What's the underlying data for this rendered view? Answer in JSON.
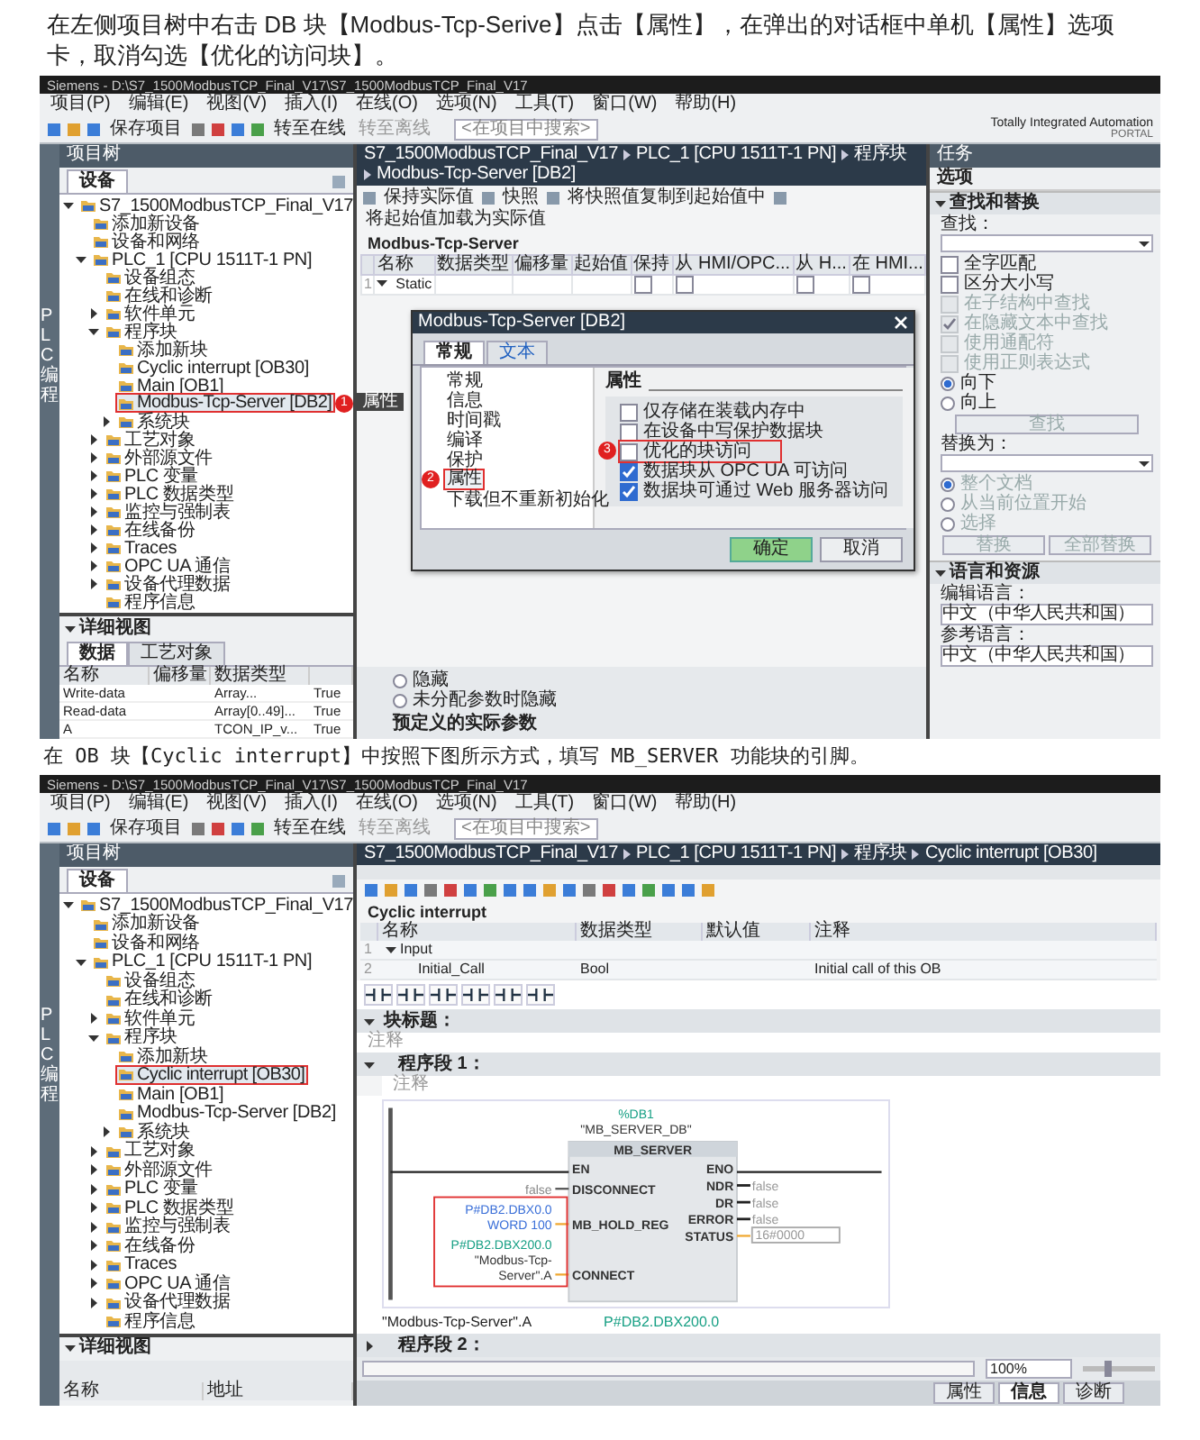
{
  "intro": "在左侧项目树中右击 DB 块【Modbus-Tcp-Serive】点击【属性】，在弹出的对话框中单机【属性】选项卡，取消勾选【优化的访问块】。",
  "screenshot_1": {
    "title": "Siemens - D:\\S7_1500ModbusTCP_Final_V17\\S7_1500ModbusTCP_Final_V17",
    "menu": [
      "项目(P)",
      "编辑(E)",
      "视图(V)",
      "插入(I)",
      "在线(O)",
      "选项(N)",
      "工具(T)",
      "窗口(W)",
      "帮助(H)"
    ],
    "toolbar": {
      "save": "保存项目",
      "online": "转至在线",
      "offline": "转至离线",
      "search_placeholder": "<在项目中搜索>"
    },
    "brand": {
      "line_1": "Totally Integrated Automation",
      "line_2": "PORTAL"
    },
    "side_tab": "PLC 编程",
    "project_tree": {
      "title": "项目树",
      "tab": "设备",
      "items": [
        {
          "label": "S7_1500ModbusTCP_Final_V17",
          "selected": false,
          "expanded": true,
          "children": [
            {
              "label": "添加新设备",
              "selected": false
            },
            {
              "label": "设备和网络",
              "selected": false
            },
            {
              "label": "PLC_1 [CPU 1511T-1 PN]",
              "selected": false,
              "expanded": true,
              "children": [
                {
                  "label": "设备组态",
                  "selected": false
                },
                {
                  "label": "在线和诊断",
                  "selected": false
                },
                {
                  "label": "软件单元",
                  "selected": false,
                  "expanded": false
                },
                {
                  "label": "程序块",
                  "selected": false,
                  "expanded": true,
                  "children": [
                    {
                      "label": "添加新块",
                      "selected": false
                    },
                    {
                      "label": "Cyclic interrupt [OB30]",
                      "selected": false
                    },
                    {
                      "label": "Main [OB1]",
                      "selected": false
                    },
                    {
                      "label": "Modbus-Tcp-Server [DB2]",
                      "selected": true,
                      "marker": "1",
                      "tooltip": "属性"
                    },
                    {
                      "label": "系统块",
                      "selected": false,
                      "expanded": false
                    }
                  ]
                },
                {
                  "label": "工艺对象",
                  "selected": false,
                  "expanded": false
                },
                {
                  "label": "外部源文件",
                  "selected": false,
                  "expanded": false
                },
                {
                  "label": "PLC 变量",
                  "selected": false,
                  "expanded": false
                },
                {
                  "label": "PLC 数据类型",
                  "selected": false,
                  "expanded": false
                },
                {
                  "label": "监控与强制表",
                  "selected": false,
                  "expanded": false
                },
                {
                  "label": "在线备份",
                  "selected": false,
                  "expanded": false
                },
                {
                  "label": "Traces",
                  "selected": false,
                  "expanded": false
                },
                {
                  "label": "OPC UA 通信",
                  "selected": false,
                  "expanded": false
                },
                {
                  "label": "设备代理数据",
                  "selected": false,
                  "expanded": false
                },
                {
                  "label": "程序信息",
                  "selected": false
                }
              ]
            }
          ]
        }
      ]
    },
    "detail_view": {
      "title": "详细视图",
      "tabs": [
        {
          "label": "数据",
          "selected": true
        },
        {
          "label": "工艺对象",
          "selected": false
        }
      ],
      "columns": [
        "名称",
        "偏移量",
        "数据类型"
      ],
      "rows": [
        {
          "name": "Write-data",
          "data_type": "Array...",
          "column_4": "True"
        },
        {
          "name": "Read-data",
          "data_type": "Array[0..49]...",
          "column_4": "True"
        },
        {
          "name": "A",
          "data_type": "TCON_IP_v...",
          "column_4": "True"
        }
      ]
    },
    "editor": {
      "breadcrumb": [
        "S7_1500ModbusTCP_Final_V17",
        "PLC_1 [CPU 1511T-1 PN]",
        "程序块",
        "Modbus-Tcp-Server [DB2]"
      ],
      "toolbar_labels": [
        "保持实际值",
        "快照",
        "将快照值复制到起始值中",
        "将起始值加载为实际值"
      ],
      "block_name": "Modbus-Tcp-Server",
      "columns": [
        "名称",
        "数据类型",
        "偏移量",
        "起始值",
        "保持",
        "从 HMI/OPC...",
        "从 H...",
        "在 HMI..."
      ],
      "rows": [
        {
          "number": "1",
          "name": "Static",
          "expanded": true,
          "flags": [
            {
              "checked": false
            },
            {
              "checked": false
            },
            {
              "checked": false
            },
            {
              "checked": false
            }
          ]
        }
      ],
      "radios": [
        {
          "label": "隐藏",
          "selected": false
        },
        {
          "label": "未分配参数时隐藏",
          "selected": false
        }
      ],
      "heading": "预定义的实际参数"
    },
    "dialog": {
      "title": "Modbus-Tcp-Server [DB2]",
      "tabs": [
        {
          "label": "常规",
          "selected": true
        },
        {
          "label": "文本",
          "selected": false
        }
      ],
      "nav": [
        {
          "label": "常规",
          "selected": false
        },
        {
          "label": "信息",
          "selected": false
        },
        {
          "label": "时间戳",
          "selected": false
        },
        {
          "label": "编译",
          "selected": false
        },
        {
          "label": "保护",
          "selected": false
        },
        {
          "label": "属性",
          "selected": true,
          "marker": "2"
        },
        {
          "label": "下载但不重新初始化",
          "selected": false
        }
      ],
      "section": "属性",
      "options": [
        {
          "label": "仅存储在装载内存中",
          "checked": false
        },
        {
          "label": "在设备中写保护数据块",
          "checked": false
        },
        {
          "label": "优化的块访问",
          "checked": false,
          "marker": "3"
        },
        {
          "label": "数据块从 OPC UA 可访问",
          "checked": true
        },
        {
          "label": "数据块可通过 Web 服务器访问",
          "checked": true
        }
      ],
      "buttons": [
        "确定",
        "取消"
      ]
    },
    "tasks": {
      "title": "任务",
      "subtitle": "选项",
      "find_replace": {
        "title": "查找和替换",
        "find_label": "查找：",
        "checkboxes": [
          {
            "label": "全字匹配",
            "checked": false,
            "disabled": false
          },
          {
            "label": "区分大小写",
            "checked": false,
            "disabled": false
          },
          {
            "label": "在子结构中查找",
            "checked": false,
            "disabled": true
          },
          {
            "label": "在隐藏文本中查找",
            "checked": true,
            "disabled": true
          },
          {
            "label": "使用通配符",
            "checked": false,
            "disabled": true
          },
          {
            "label": "使用正则表达式",
            "checked": false,
            "disabled": true
          }
        ],
        "direction": [
          {
            "label": "向下",
            "selected": true
          },
          {
            "label": "向上",
            "selected": false
          }
        ],
        "find_button": "查找",
        "replace_label": "替换为：",
        "scope": [
          {
            "label": "整个文档",
            "selected": true
          },
          {
            "label": "从当前位置开始",
            "selected": false
          },
          {
            "label": "选择",
            "selected": false
          }
        ],
        "buttons": [
          "替换",
          "全部替换"
        ]
      },
      "language": {
        "title": "语言和资源",
        "edit_label": "编辑语言：",
        "edit_value": "中文（中华人民共和国）",
        "reference_label": "参考语言：",
        "reference_value": "中文（中华人民共和国）"
      }
    }
  },
  "caption": "在 OB 块【Cyclic interrupt】中按照下图所示方式，填写 MB_SERVER 功能块的引脚。",
  "screenshot_2": {
    "title": "Siemens - D:\\S7_1500ModbusTCP_Final_V17\\S7_1500ModbusTCP_Final_V17",
    "menu": [
      "项目(P)",
      "编辑(E)",
      "视图(V)",
      "插入(I)",
      "在线(O)",
      "选项(N)",
      "工具(T)",
      "窗口(W)",
      "帮助(H)"
    ],
    "toolbar": {
      "save": "保存项目",
      "online": "转至在线",
      "offline": "转至离线",
      "search_placeholder": "<在项目中搜索>"
    },
    "side_tab": "PLC 编程",
    "project_tree": {
      "title": "项目树",
      "tab": "设备",
      "items": [
        {
          "label": "S7_1500ModbusTCP_Final_V17",
          "selected": false,
          "expanded": true,
          "children": [
            {
              "label": "添加新设备",
              "selected": false
            },
            {
              "label": "设备和网络",
              "selected": false
            },
            {
              "label": "PLC_1 [CPU 1511T-1 PN]",
              "selected": false,
              "expanded": true,
              "children": [
                {
                  "label": "设备组态",
                  "selected": false
                },
                {
                  "label": "在线和诊断",
                  "selected": false
                },
                {
                  "label": "软件单元",
                  "selected": false,
                  "expanded": false
                },
                {
                  "label": "程序块",
                  "selected": false,
                  "expanded": true,
                  "children": [
                    {
                      "label": "添加新块",
                      "selected": false
                    },
                    {
                      "label": "Cyclic interrupt [OB30]",
                      "selected": true
                    },
                    {
                      "label": "Main [OB1]",
                      "selected": false
                    },
                    {
                      "label": "Modbus-Tcp-Server [DB2]",
                      "selected": false
                    },
                    {
                      "label": "系统块",
                      "selected": false,
                      "expanded": false
                    }
                  ]
                },
                {
                  "label": "工艺对象",
                  "selected": false,
                  "expanded": false
                },
                {
                  "label": "外部源文件",
                  "selected": false,
                  "expanded": false
                },
                {
                  "label": "PLC 变量",
                  "selected": false,
                  "expanded": false
                },
                {
                  "label": "PLC 数据类型",
                  "selected": false,
                  "expanded": false
                },
                {
                  "label": "监控与强制表",
                  "selected": false,
                  "expanded": false
                },
                {
                  "label": "在线备份",
                  "selected": false,
                  "expanded": false
                },
                {
                  "label": "Traces",
                  "selected": false,
                  "expanded": false
                },
                {
                  "label": "OPC UA 通信",
                  "selected": false,
                  "expanded": false
                },
                {
                  "label": "设备代理数据",
                  "selected": false,
                  "expanded": false
                },
                {
                  "label": "程序信息",
                  "selected": false
                }
              ]
            }
          ]
        }
      ]
    },
    "detail_view": {
      "title": "详细视图",
      "columns": [
        "名称",
        "地址"
      ]
    },
    "editor": {
      "breadcrumb": [
        "S7_1500ModbusTCP_Final_V17",
        "PLC_1 [CPU 1511T-1 PN]",
        "程序块",
        "Cyclic interrupt [OB30]"
      ],
      "block_name": "Cyclic interrupt",
      "columns": [
        "名称",
        "数据类型",
        "默认值",
        "注释"
      ],
      "rows": [
        {
          "number": "1",
          "name": "Input",
          "expanded": true
        },
        {
          "number": "2",
          "name": "Initial_Call",
          "data_type": "Bool",
          "comment": "Initial call of this OB"
        }
      ],
      "block_title": {
        "label": "块标题：",
        "comment": "注释"
      },
      "network_1": {
        "label": "程序段 1：",
        "expanded": true,
        "comment": "注释"
      },
      "fb": {
        "instance": "%DB1",
        "instance_name": "\"MB_SERVER_DB\"",
        "name": "MB_SERVER",
        "highlight_actuals": true,
        "inputs": [
          {
            "pin": "EN"
          },
          {
            "pin": "DISCONNECT",
            "actual": [
              {
                "text": "false",
                "color": "#8a8a8a"
              }
            ]
          },
          {
            "pin": "MB_HOLD_REG",
            "actual": [
              {
                "text": "P#DB2.DBX0.0",
                "color": "#3a6fd8"
              },
              {
                "text": "WORD 100",
                "color": "#3a6fd8"
              }
            ]
          },
          {
            "pin": "CONNECT",
            "actual": [
              {
                "text": "P#DB2.DBX200.0",
                "color": "#18a085"
              },
              {
                "text": "\"Modbus-Tcp-",
                "color": "#333333"
              },
              {
                "text": "Server\".A",
                "color": "#333333"
              }
            ]
          }
        ],
        "outputs": [
          {
            "pin": "ENO",
            "kind": "flow"
          },
          {
            "pin": "NDR",
            "kind": "bool",
            "value": "false"
          },
          {
            "pin": "DR",
            "kind": "bool",
            "value": "false"
          },
          {
            "pin": "ERROR",
            "kind": "bool",
            "value": "false"
          },
          {
            "pin": "STATUS",
            "kind": "field",
            "value": "16#0000"
          }
        ]
      },
      "info_row": {
        "symbol": "\"Modbus-Tcp-Server\".A",
        "address": "P#DB2.DBX200.0"
      },
      "network_2": {
        "label": "程序段 2：",
        "expanded": false
      },
      "zoom": "100%",
      "zoom_slider": {
        "level": 0.35
      },
      "bottom_tabs": [
        {
          "label": "属性",
          "selected": false
        },
        {
          "label": "信息",
          "selected": true
        },
        {
          "label": "诊断",
          "selected": false
        }
      ]
    }
  }
}
